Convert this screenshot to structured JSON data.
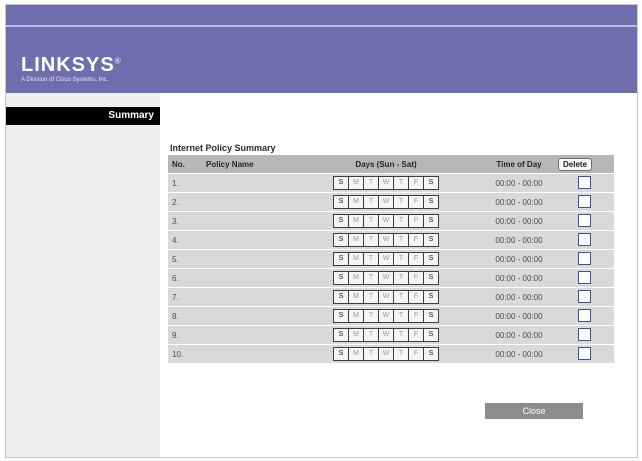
{
  "brand": {
    "name": "LINKSYS",
    "mark": "®",
    "tagline": "A Division of Cisco Systems, Inc."
  },
  "sidebar": {
    "active_item": "Summary"
  },
  "main": {
    "title": "Internet Policy Summary",
    "headers": {
      "no": "No.",
      "policy_name": "Policy Name",
      "days": "Days (Sun - Sat)",
      "time": "Time of Day",
      "delete": "Delete"
    },
    "day_letters": [
      "S",
      "M",
      "T",
      "W",
      "T",
      "F",
      "S"
    ],
    "rows": [
      {
        "no": "1.",
        "policy_name": "",
        "time": "00:00 - 00:00"
      },
      {
        "no": "2.",
        "policy_name": "",
        "time": "00:00 - 00:00"
      },
      {
        "no": "3.",
        "policy_name": "",
        "time": "00:00 - 00:00"
      },
      {
        "no": "4.",
        "policy_name": "",
        "time": "00:00 - 00:00"
      },
      {
        "no": "5.",
        "policy_name": "",
        "time": "00:00 - 00:00"
      },
      {
        "no": "6.",
        "policy_name": "",
        "time": "00:00 - 00:00"
      },
      {
        "no": "7.",
        "policy_name": "",
        "time": "00:00 - 00:00"
      },
      {
        "no": "8.",
        "policy_name": "",
        "time": "00:00 - 00:00"
      },
      {
        "no": "9.",
        "policy_name": "",
        "time": "00:00 - 00:00"
      },
      {
        "no": "10.",
        "policy_name": "",
        "time": "00:00 - 00:00"
      }
    ],
    "close_label": "Close"
  },
  "colors": {
    "brand_purple": "#6c6eae",
    "header_gray": "#b7b7b7",
    "row_gray": "#d9d9d9",
    "close_gray": "#8c8c8c"
  }
}
